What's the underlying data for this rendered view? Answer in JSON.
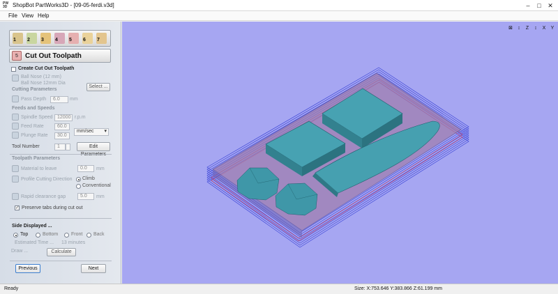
{
  "window": {
    "app_icon_text": "PW 3D",
    "title": "ShopBot PartWorks3D - [09-05-ferdi.v3d]",
    "minimize_glyph": "–",
    "maximize_glyph": "□",
    "close_glyph": "✕"
  },
  "menu": {
    "items": [
      "File",
      "View",
      "Help"
    ]
  },
  "panel": {
    "toolbar_numbers": [
      "1",
      "2",
      "3",
      "4",
      "5",
      "6",
      "7"
    ],
    "header_icon_text": "5",
    "header_title": "Cut Out Toolpath",
    "create_label": "Create Cut Out Toolpath",
    "tool_name": "Ball Nose (12 mm)",
    "tool_desc": "Ball Nose 12mm Dia",
    "select_button": "Select ...",
    "cutting_section": "Cutting Parameters",
    "pass_depth_label": "Pass Depth",
    "pass_depth_value": "6.0",
    "pass_depth_unit": "mm",
    "feeds_section": "Feeds and Speeds",
    "spindle_label": "Spindle Speed",
    "spindle_value": "12000",
    "spindle_unit": "r.p.m",
    "feed_label": "Feed Rate",
    "feed_value": "60.0",
    "plunge_label": "Plunge Rate",
    "plunge_value": "30.0",
    "rate_unit": "mm/sec",
    "tool_number_label": "Tool Number",
    "tool_number_value": "1",
    "edit_params_button": "Edit Parameters",
    "toolpath_section": "Toolpath Parameters",
    "material_leave_label": "Material to leave",
    "material_leave_value": "0.0",
    "material_leave_unit": "mm",
    "profile_direction_label": "Profile Cutting Direction",
    "climb_label": "Climb",
    "conventional_label": "Conventional",
    "rapid_gap_label": "Rapid clearance gap",
    "rapid_gap_value": "5.0",
    "rapid_gap_unit": "mm",
    "preserve_tabs_label": "Preserve tabs during cut out",
    "side_section": "Side Displayed ...",
    "side_top": "Top",
    "side_bottom": "Bottom",
    "side_front": "Front",
    "side_back": "Back",
    "estimated_label": "Estimated Time ...",
    "estimated_value": "13 minutes",
    "draw_label": "Draw ...",
    "calculate_button": "Calculate",
    "previous_button": "Previous",
    "next_button": "Next"
  },
  "view_icons": [
    "⊠",
    "↕",
    "Z",
    "↕",
    "X",
    "Y"
  ],
  "status": {
    "ready": "Ready",
    "size": "Size: X:753.646 Y:383.866 Z:61.199 mm"
  },
  "colors": {
    "viewport_bg": "#a6a6f2",
    "model_teal": "#3f97a8",
    "toolpath_blue": "#3c46d8",
    "toolpath_red": "#c44066"
  }
}
